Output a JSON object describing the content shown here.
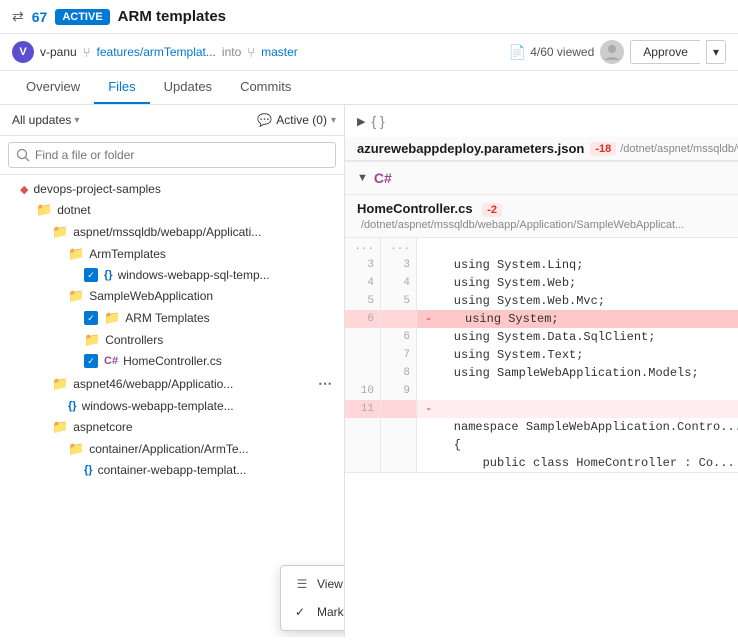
{
  "header": {
    "pr_icon": "⇄",
    "pr_number": "67",
    "active_badge": "ACTIVE",
    "pr_title": "ARM templates"
  },
  "subheader": {
    "author_initials": "V",
    "author": "v-panu",
    "branch_from": "features/armTemplat...",
    "into": "into",
    "branch_to": "master",
    "viewed": "4/60 viewed",
    "approve_label": "Approve"
  },
  "nav": {
    "tabs": [
      "Overview",
      "Files",
      "Updates",
      "Commits"
    ]
  },
  "left_panel": {
    "filter_all_updates": "All updates",
    "filter_active": "Active (0)",
    "search_placeholder": "Find a file or folder",
    "tree": [
      {
        "id": "root",
        "label": "devops-project-samples",
        "type": "diamond",
        "indent": 0,
        "checked": false
      },
      {
        "id": "dotnet",
        "label": "dotnet",
        "type": "folder",
        "indent": 1,
        "checked": false
      },
      {
        "id": "aspnet",
        "label": "aspnet/mssqldb/webapp/Applicati...",
        "type": "folder",
        "indent": 2,
        "checked": false
      },
      {
        "id": "armtemplates",
        "label": "ArmTemplates",
        "type": "folder",
        "indent": 3,
        "checked": false
      },
      {
        "id": "windows-sql",
        "label": "windows-webapp-sql-temp...",
        "type": "file-json",
        "indent": 4,
        "checked": true
      },
      {
        "id": "samplewebapp",
        "label": "SampleWebApplication",
        "type": "folder",
        "indent": 3,
        "checked": false
      },
      {
        "id": "arm-templates2",
        "label": "ARM Templates",
        "type": "folder",
        "indent": 4,
        "checked": true
      },
      {
        "id": "controllers",
        "label": "Controllers",
        "type": "folder",
        "indent": 4,
        "checked": false
      },
      {
        "id": "homecontroller",
        "label": "HomeController.cs",
        "type": "cs",
        "indent": 5,
        "checked": true
      },
      {
        "id": "aspnet46",
        "label": "aspnet46/webapp/Applicatio...",
        "type": "folder",
        "indent": 2,
        "checked": false,
        "kebab": true
      },
      {
        "id": "windows-template",
        "label": "windows-webapp-template...",
        "type": "file-json",
        "indent": 3,
        "checked": false
      },
      {
        "id": "aspnetcore",
        "label": "aspnetcore",
        "type": "folder",
        "indent": 2,
        "checked": false
      },
      {
        "id": "container-arm",
        "label": "container/Application/ArmTe...",
        "type": "folder",
        "indent": 3,
        "checked": false
      },
      {
        "id": "container-template",
        "label": "container-webapp-templat...",
        "type": "file-json",
        "indent": 4,
        "checked": false
      }
    ]
  },
  "context_menu": {
    "items": [
      {
        "id": "view-explorer",
        "label": "View in file explorer",
        "icon": "☰",
        "checked": false
      },
      {
        "id": "mark-reviewed",
        "label": "Mark as reviewed",
        "icon": "✓",
        "checked": true
      }
    ]
  },
  "right_panel": {
    "sections": [
      {
        "id": "json-section",
        "collapsed": true,
        "toggle": "▶",
        "icon": "{ }",
        "file_name": "azurewebappdeploy.parameters.json",
        "badge": "-18",
        "path": "/dotnet/aspnet/mssqldb/webapp/Application/SampleWebApplicat..."
      },
      {
        "id": "cs-section",
        "collapsed": false,
        "toggle": "▼",
        "lang": "C#",
        "file_name": "HomeController.cs",
        "badge": "-2",
        "path": "/dotnet/aspnet/mssqldb/webapp/Application/SampleWebApplicat...",
        "code_lines": [
          {
            "old": "...",
            "new": "...",
            "content": "",
            "type": "dots"
          },
          {
            "old": "3",
            "new": "3",
            "content": "    using System.Linq;",
            "type": "normal"
          },
          {
            "old": "4",
            "new": "4",
            "content": "    using System.Web;",
            "type": "normal"
          },
          {
            "old": "5",
            "new": "5",
            "content": "    using System.Web.Mvc;",
            "type": "normal"
          },
          {
            "old": "6",
            "new": "",
            "content": "    using System;",
            "type": "removed-solid",
            "marker": "-"
          },
          {
            "old": "",
            "new": "6",
            "content": "    using System.Data.SqlClient;",
            "type": "normal"
          },
          {
            "old": "",
            "new": "7",
            "content": "    using System.Text;",
            "type": "normal"
          },
          {
            "old": "",
            "new": "8",
            "content": "    using SampleWebApplication.Models;",
            "type": "normal"
          },
          {
            "old": "10",
            "new": "9",
            "content": "",
            "type": "normal"
          },
          {
            "old": "11",
            "new": "",
            "content": "",
            "type": "removed-indicator"
          }
        ],
        "namespace_line": "    namespace SampleWebApplication.Contro...",
        "brace_line": "    {",
        "class_line": "        public class HomeController : Co..."
      }
    ]
  }
}
